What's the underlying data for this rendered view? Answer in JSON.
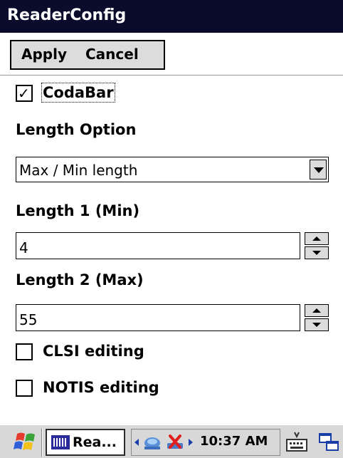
{
  "window": {
    "title": "ReaderConfig"
  },
  "menu": {
    "apply_label": "Apply",
    "cancel_label": "Cancel"
  },
  "symbology": {
    "label": "CodaBar",
    "checked": true
  },
  "length_option": {
    "label": "Length Option",
    "selected": "Max / Min length"
  },
  "length1": {
    "label": "Length 1 (Min)",
    "value": "4"
  },
  "length2": {
    "label": "Length 2 (Max)",
    "value": "55"
  },
  "options": [
    {
      "label": "CLSI editing",
      "checked": false
    },
    {
      "label": "NOTIS editing",
      "checked": false
    }
  ],
  "taskbar": {
    "task_label": "Rea...",
    "clock": "10:37 AM"
  },
  "colors": {
    "titlebar": "#0b0b2c",
    "taskbar": "#d8d8d8",
    "button_face": "#dcdcdc"
  }
}
